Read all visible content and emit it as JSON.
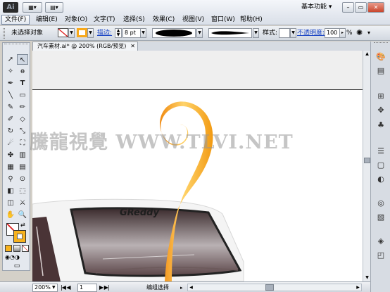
{
  "app": {
    "logo": "Ai",
    "workspace": "基本功能"
  },
  "window_controls": {
    "minimize": "–",
    "restore": "▭",
    "close": "✕"
  },
  "menus": [
    "文件(F)",
    "编辑(E)",
    "对象(O)",
    "文字(T)",
    "选择(S)",
    "效果(C)",
    "视图(V)",
    "窗口(W)",
    "帮助(H)"
  ],
  "control_bar": {
    "selection": "未选择对象",
    "stroke_label": "描边:",
    "stroke_weight": "8 pt",
    "style_label": "样式:",
    "opacity_label": "不透明度:",
    "opacity_value": "100",
    "opacity_unit": "%"
  },
  "document": {
    "tab_title": "汽车素材.ai* @ 200% (RGB/预览)",
    "tab_close": "✕"
  },
  "canvas": {
    "car_logo_text": "GReddy",
    "watermark": "騰龍視覺 WWW.TLVI.NET"
  },
  "status_bar": {
    "zoom": "200%",
    "page": "1",
    "tool_status": "编组选择"
  },
  "colors": {
    "accent_orange": "#f5a21c",
    "fill_swatch": "#f7b21e",
    "stroke_swatch": "#ffffff"
  },
  "tools": [
    "selection-tool",
    "direct-selection-tool",
    "magic-wand-tool",
    "lasso-tool",
    "pen-tool",
    "type-tool",
    "line-tool",
    "rectangle-tool",
    "paintbrush-tool",
    "pencil-tool",
    "blob-brush-tool",
    "eraser-tool",
    "rotate-tool",
    "scale-tool",
    "warp-tool",
    "free-transform-tool",
    "symbol-sprayer-tool",
    "column-graph-tool",
    "mesh-tool",
    "gradient-tool",
    "eyedropper-tool",
    "blend-tool",
    "live-paint-tool",
    "live-paint-selection-tool",
    "artboard-tool",
    "slice-tool",
    "hand-tool",
    "zoom-tool"
  ],
  "dock_icons": [
    "color-icon",
    "color-guide-icon",
    "swatches-icon",
    "brushes-icon",
    "symbols-icon",
    "stroke-icon",
    "gradient-icon",
    "transparency-icon",
    "appearance-icon",
    "graphic-styles-icon",
    "layers-icon",
    "artboards-icon"
  ]
}
